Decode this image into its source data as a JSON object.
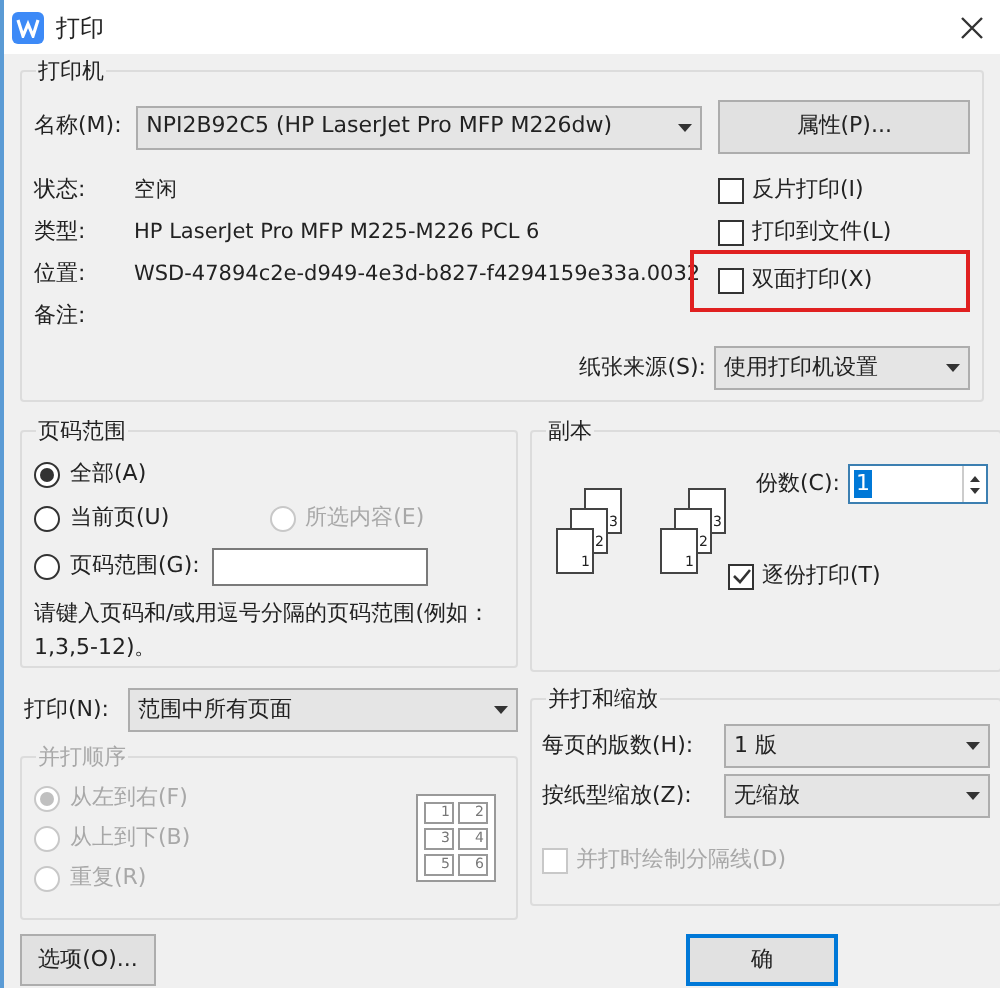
{
  "window": {
    "title": "打印"
  },
  "printer": {
    "group_label": "打印机",
    "name_label": "名称(M):",
    "name_value": "NPI2B92C5 (HP LaserJet Pro MFP M226dw)",
    "properties_button": "属性(P)...",
    "info": [
      {
        "label": "状态:",
        "value": "空闲"
      },
      {
        "label": "类型:",
        "value": "HP LaserJet Pro MFP M225-M226 PCL 6"
      },
      {
        "label": "位置:",
        "value": "WSD-47894c2e-d949-4e3d-b827-f4294159e33a.0032"
      },
      {
        "label": "备注:"
      }
    ],
    "options": [
      {
        "label": "反片打印(I)",
        "checked": false,
        "highlighted": false
      },
      {
        "label": "打印到文件(L)",
        "checked": false,
        "highlighted": false
      },
      {
        "label": "双面打印(X)",
        "checked": false,
        "highlighted": true
      }
    ],
    "paper_source": {
      "label": "纸张来源(S):",
      "value": "使用打印机设置"
    }
  },
  "page_range": {
    "label": "页码范围",
    "options": [
      {
        "label": "全部(A)",
        "selected": true,
        "disabled": false
      },
      {
        "label": "当前页(U)",
        "selected": false,
        "disabled": false
      },
      {
        "label": "所选内容(E)",
        "selected": false,
        "disabled": true
      },
      {
        "label": "页码范围(G):",
        "selected": false,
        "disabled": false
      }
    ],
    "hint": "请键入页码和/或用逗号分隔的页码范围(例如：1,3,5-12)。"
  },
  "copies": {
    "label": "副本",
    "stacks": [
      [
        "3",
        "2",
        "1"
      ],
      [
        "3",
        "2",
        "1"
      ]
    ],
    "count_label": "份数(C):",
    "count_value": "1",
    "collate": {
      "label": "逐份打印(T)",
      "checked": true
    }
  },
  "print_what": {
    "label": "打印(N):",
    "value": "范围中所有页面"
  },
  "order": {
    "label": "并打顺序",
    "disabled": true,
    "options": [
      {
        "label": "从左到右(F)",
        "selected": true
      },
      {
        "label": "从上到下(B)",
        "selected": false
      },
      {
        "label": "重复(R)",
        "selected": false
      }
    ],
    "preview_numbers": [
      "1",
      "2",
      "3",
      "4",
      "5",
      "6"
    ]
  },
  "scaling": {
    "label": "并打和缩放",
    "pages_per_sheet": {
      "label": "每页的版数(H):",
      "value": "1 版"
    },
    "scale": {
      "label": "按纸型缩放(Z):",
      "value": "无缩放"
    },
    "draw_borders": {
      "label": "并打时绘制分隔线(D)",
      "checked": false,
      "disabled": true
    }
  },
  "buttons": {
    "options": "选项(O)...",
    "ok": "确"
  }
}
